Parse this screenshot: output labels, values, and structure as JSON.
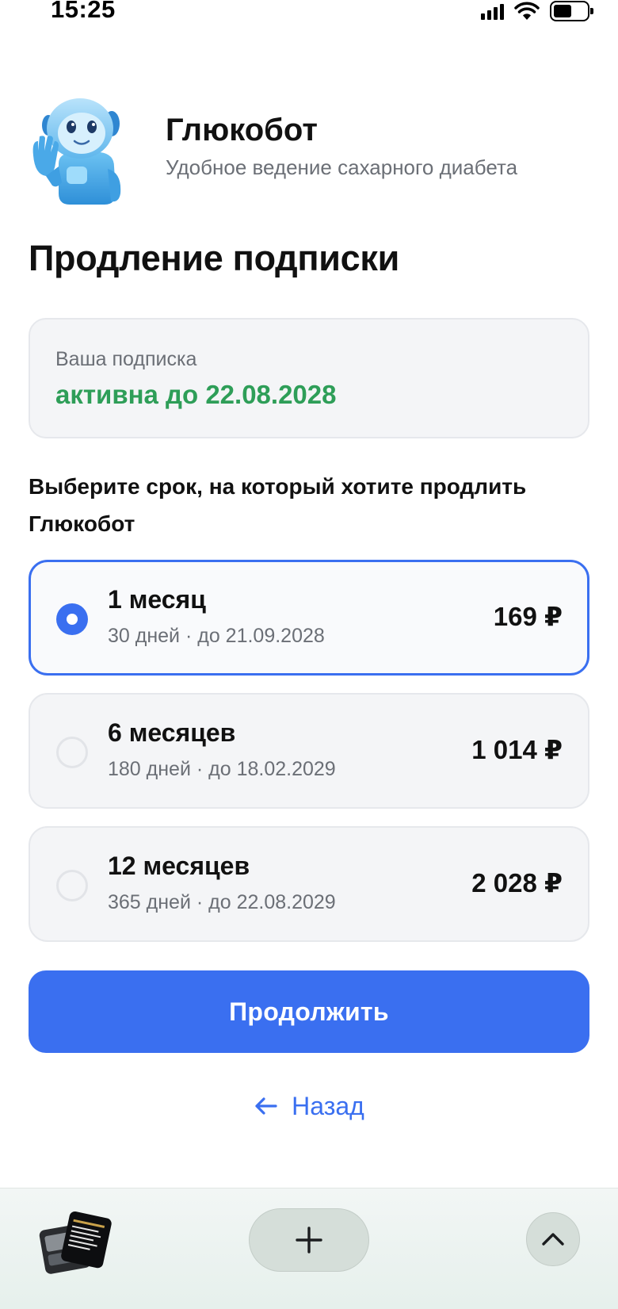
{
  "status_bar": {
    "time": "15:25"
  },
  "brand": {
    "name": "Глюкобот",
    "tagline": "Удобное ведение сахарного диабета"
  },
  "page_title": "Продление подписки",
  "subscription": {
    "label": "Ваша подписка",
    "status": "активна до 22.08.2028"
  },
  "prompt": "Выберите срок, на который хотите продлить Глюкобот",
  "plans": [
    {
      "name": "1 месяц",
      "detail": "30 дней · до 21.09.2028",
      "price": "169 ₽",
      "selected": true
    },
    {
      "name": "6 месяцев",
      "detail": "180 дней · до 18.02.2029",
      "price": "1 014 ₽",
      "selected": false
    },
    {
      "name": "12 месяцев",
      "detail": "365 дней · до 22.08.2029",
      "price": "2 028 ₽",
      "selected": false
    }
  ],
  "actions": {
    "continue_label": "Продолжить",
    "back_label": "Назад"
  },
  "colors": {
    "accent": "#3a6ff0",
    "success": "#2e9e58",
    "muted_text": "#6b6f76",
    "card_bg": "#f4f5f7"
  },
  "icons": {
    "status_bar": [
      "signal-icon",
      "wifi-icon",
      "battery-icon"
    ],
    "back": "arrow-left-icon",
    "bottom_bar": [
      "tabs-thumbnail",
      "plus-icon",
      "chevron-up-icon"
    ]
  }
}
